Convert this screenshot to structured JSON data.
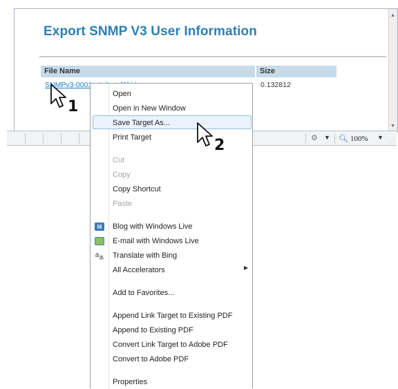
{
  "page": {
    "title": "Export SNMP V3 User Information",
    "table": {
      "headers": [
        "File Name",
        "Size"
      ],
      "rows": [
        {
          "file": "SNMPv3-0001-attribute[1].id",
          "size": "0.132812"
        }
      ]
    }
  },
  "statusbar": {
    "zoom": "100%"
  },
  "context_menu": {
    "items": [
      {
        "label": "Open",
        "enabled": true
      },
      {
        "label": "Open in New Window",
        "enabled": true
      },
      {
        "label": "Save Target As...",
        "enabled": true,
        "highlighted": true
      },
      {
        "label": "Print Target",
        "enabled": true
      },
      {
        "label": "Cut",
        "enabled": false
      },
      {
        "label": "Copy",
        "enabled": false
      },
      {
        "label": "Copy Shortcut",
        "enabled": true
      },
      {
        "label": "Paste",
        "enabled": false
      },
      {
        "label": "Blog with Windows Live",
        "enabled": true,
        "icon": "blog-icon"
      },
      {
        "label": "E-mail with Windows Live",
        "enabled": true,
        "icon": "email-icon"
      },
      {
        "label": "Translate with Bing",
        "enabled": true,
        "icon": "translate-icon"
      },
      {
        "label": "All Accelerators",
        "enabled": true,
        "submenu": true
      },
      {
        "label": "Add to Favorites...",
        "enabled": true
      },
      {
        "label": "Append Link Target to Existing PDF",
        "enabled": true
      },
      {
        "label": "Append to Existing PDF",
        "enabled": true
      },
      {
        "label": "Convert Link Target to Adobe PDF",
        "enabled": true
      },
      {
        "label": "Convert to Adobe PDF",
        "enabled": true
      },
      {
        "label": "Properties",
        "enabled": true
      }
    ]
  },
  "callouts": {
    "step1": "1",
    "step2": "2"
  },
  "colors": {
    "title": "#2b7fb3",
    "table_header": "#c6daea",
    "link": "#1a7ec6",
    "menu_highlight": "#eaf2fb"
  }
}
